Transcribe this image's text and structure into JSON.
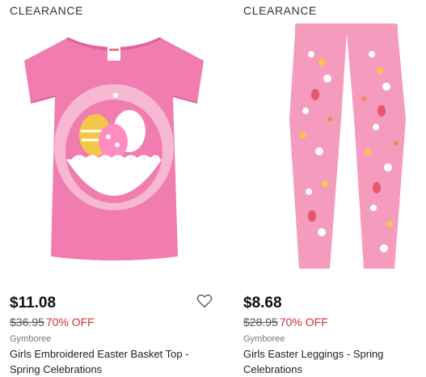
{
  "products": [
    {
      "badge": "CLEARANCE",
      "price": "$11.08",
      "original_price": "$36.95",
      "discount": "70% OFF",
      "brand": "Gymboree",
      "name": "Girls Embroidered Easter Basket Top - Spring Celebrations",
      "image_icon": "pink-tshirt-easter-basket",
      "favorite_icon": "heart-outline-icon"
    },
    {
      "badge": "CLEARANCE",
      "price": "$8.68",
      "original_price": "$28.95",
      "discount": "70% OFF",
      "brand": "Gymboree",
      "name": "Girls Easter Leggings - Spring Celebrations",
      "image_icon": "pink-easter-leggings"
    }
  ],
  "colors": {
    "discount": "#d0312d",
    "shirt_pink": "#f07cb0",
    "leggings_pink": "#f59bbd"
  }
}
